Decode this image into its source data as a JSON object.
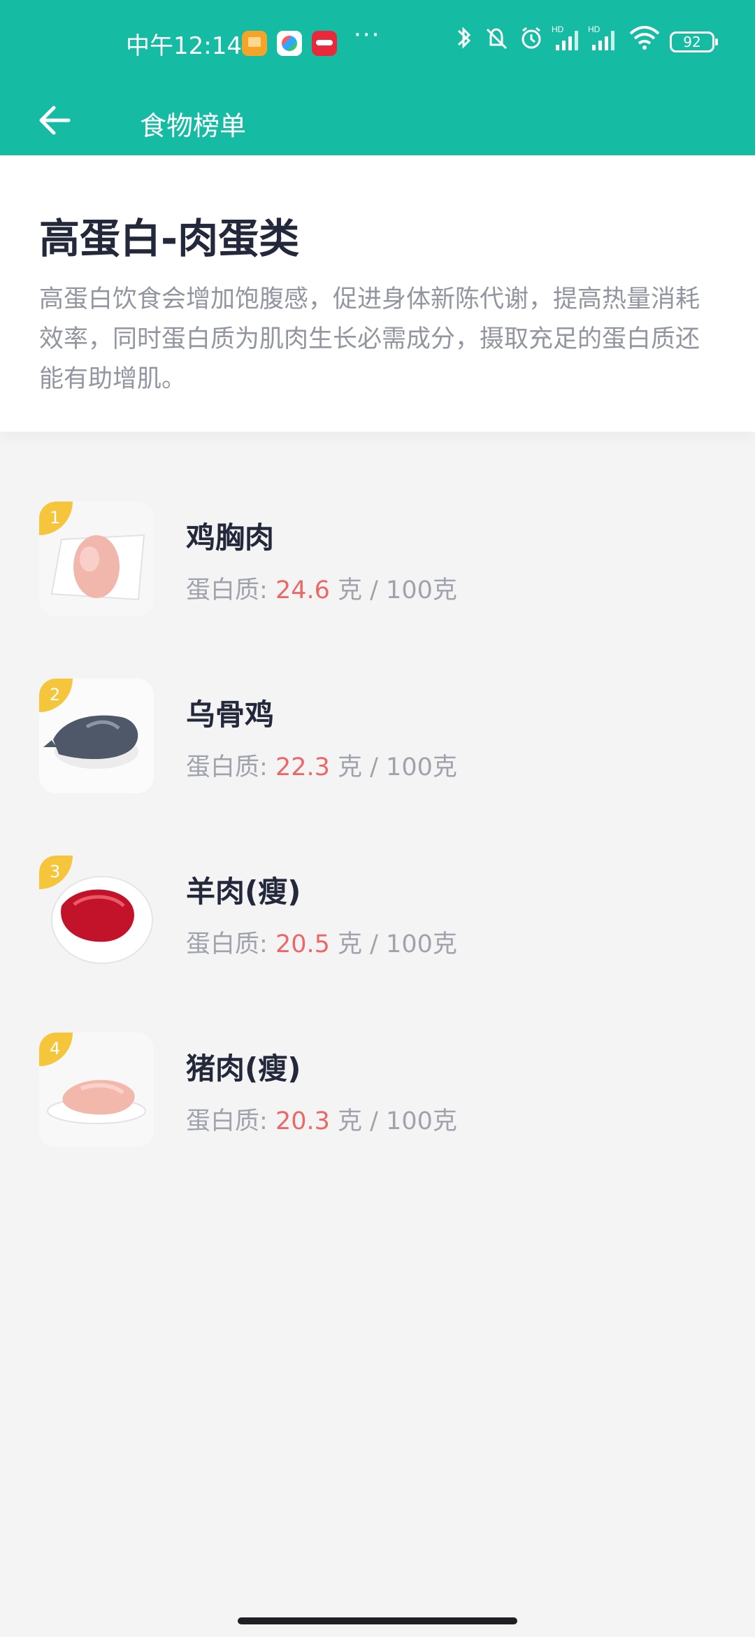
{
  "status_bar": {
    "time": "中午12:14",
    "more": "···",
    "battery": "92",
    "icons": [
      "bluetooth-icon",
      "silent-icon",
      "alarm-icon",
      "signal-icon",
      "signal-icon",
      "wifi-icon",
      "battery-icon"
    ]
  },
  "app_bar": {
    "title": "食物榜单",
    "back_icon": "arrow-left-icon"
  },
  "header": {
    "title": "高蛋白-肉蛋类",
    "description": "高蛋白饮食会增加饱腹感，促进身体新陈代谢，提高热量消耗效率，同时蛋白质为肌肉生长必需成分，摄取充足的蛋白质还能有助增肌。"
  },
  "items": [
    {
      "rank": "1",
      "name": "鸡胸肉",
      "label": "蛋白质:",
      "value": "24.6",
      "unit": "克 / 100克"
    },
    {
      "rank": "2",
      "name": "乌骨鸡",
      "label": "蛋白质:",
      "value": "22.3",
      "unit": "克 / 100克"
    },
    {
      "rank": "3",
      "name": "羊肉(瘦)",
      "label": "蛋白质:",
      "value": "20.5",
      "unit": "克 / 100克"
    },
    {
      "rank": "4",
      "name": "猪肉(瘦)",
      "label": "蛋白质:",
      "value": "20.3",
      "unit": "克 / 100克"
    }
  ],
  "colors": {
    "primary": "#16bba4",
    "rank_badge": "#f5c63c",
    "protein_value": "#eb6867"
  }
}
